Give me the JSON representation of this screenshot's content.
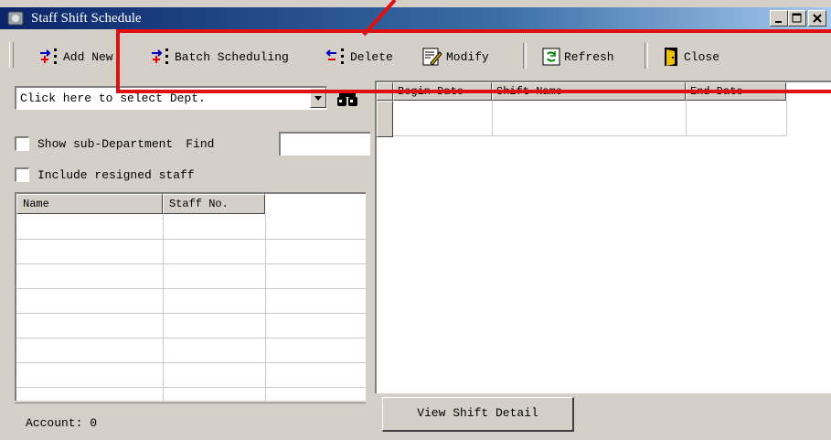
{
  "window": {
    "title": "Staff Shift Schedule"
  },
  "toolbar": {
    "add_new": "Add New",
    "batch_scheduling": "Batch Scheduling",
    "delete": "Delete",
    "modify": "Modify",
    "refresh": "Refresh",
    "close": "Close"
  },
  "left_panel": {
    "dept_select": "Click here to select Dept.",
    "show_sub_department": "Show sub-Department",
    "find_label": "Find",
    "include_resigned": "Include resigned staff",
    "columns": [
      "Name",
      "Staff No."
    ],
    "account_label": "Account: 0"
  },
  "right_panel": {
    "columns": [
      "Begin Date",
      "Shift Name",
      "End Date"
    ],
    "view_detail_button": "View Shift Detail"
  },
  "colors": {
    "title_bar": "#0a246a",
    "window_face": "#d4d0c8",
    "highlight_box": "#e01010"
  }
}
